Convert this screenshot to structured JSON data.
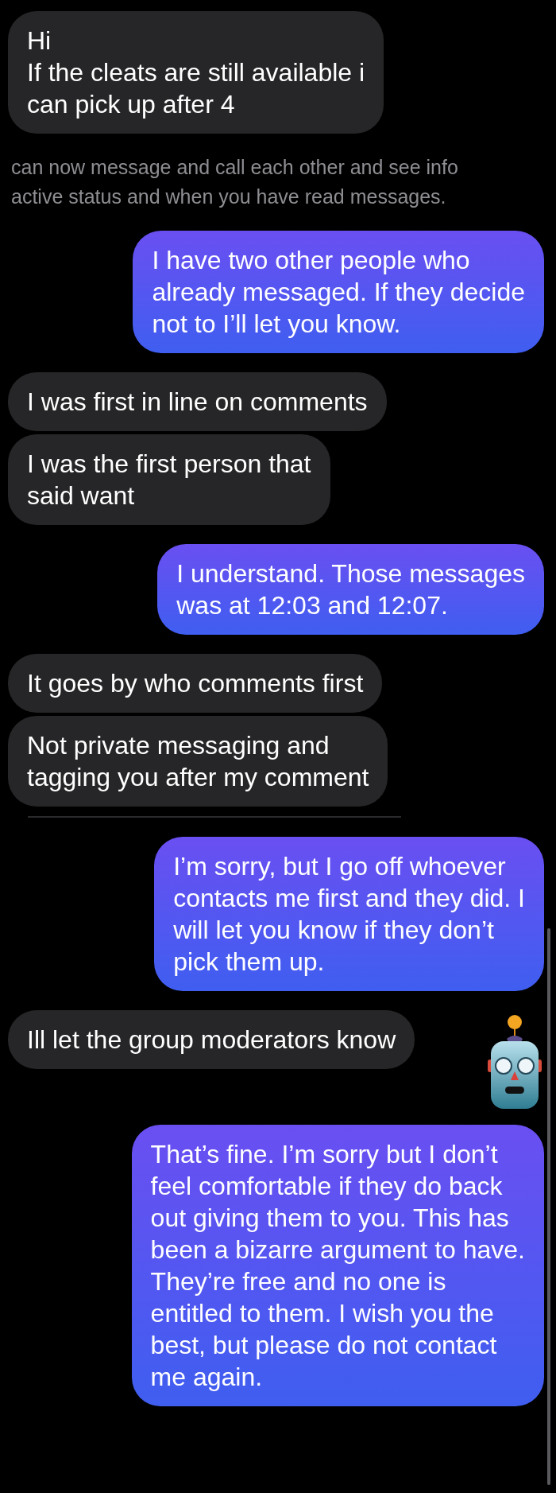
{
  "items": [
    {
      "kind": "received",
      "text": "Hi\nIf the cleats are still available i\ncan pick up after 4"
    },
    {
      "kind": "info",
      "lines": [
        "can now message and call each other and see info",
        "active status and when you have read messages."
      ]
    },
    {
      "kind": "sent",
      "text": "I have two other people who\nalready messaged. If they decide\nnot to I’ll let you know."
    },
    {
      "kind": "received",
      "text": "I was first in line on comments"
    },
    {
      "kind": "received",
      "text": "I was the first person that\nsaid want"
    },
    {
      "kind": "sent",
      "text": "I understand. Those messages\nwas at 12:03 and 12:07."
    },
    {
      "kind": "received",
      "text": "It goes by who comments first"
    },
    {
      "kind": "received",
      "text": "Not private messaging and\ntagging you after my comment"
    },
    {
      "kind": "divider"
    },
    {
      "kind": "sent",
      "text": "I’m sorry, but I go off whoever\ncontacts me first and they did. I\nwill let you know if they don’t\npick them up."
    },
    {
      "kind": "received",
      "text": "Ill let the group moderators know"
    },
    {
      "kind": "robot_sticker"
    },
    {
      "kind": "sent",
      "text": "That’s fine. I’m sorry but I don’t\nfeel comfortable if they do back\nout giving them to you. This has\nbeen a bizarre argument to have.\nThey’re free and no one is\nentitled to them. I wish you the\nbest, but please do not contact\nme again."
    }
  ]
}
